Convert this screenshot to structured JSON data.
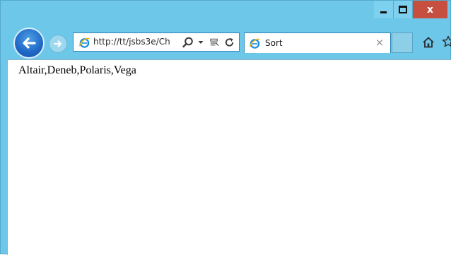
{
  "window": {
    "minimize_icon": "minimize-icon",
    "maximize_icon": "maximize-icon",
    "close_glyph": "x"
  },
  "navigation": {
    "back_icon": "back-arrow-icon",
    "forward_icon": "forward-arrow-icon"
  },
  "address_bar": {
    "url": "http://tt/jsbs3e/Ch",
    "search_icon": "search-icon",
    "dropdown_icon": "chevron-down-icon",
    "compat_icon": "compatibility-view-icon",
    "refresh_icon": "refresh-icon"
  },
  "tab": {
    "title": "Sort",
    "close_glyph": "×"
  },
  "toolbar": {
    "home_icon": "home-icon",
    "favorites_icon": "star-icon"
  },
  "page": {
    "text": "Altair,Deneb,Polaris,Vega"
  },
  "colors": {
    "frame": "#6dc7e9",
    "close_button": "#c74f3f",
    "back_button": "#1e67c5"
  }
}
